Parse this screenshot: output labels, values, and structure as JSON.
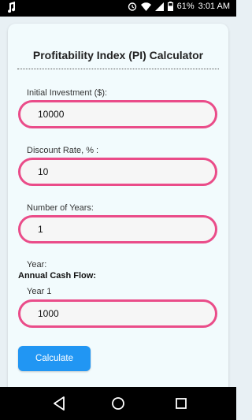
{
  "status_bar": {
    "battery_text": "61%",
    "time": "3:01 AM",
    "left_icon": "music-note-icon"
  },
  "calculator": {
    "title": "Profitability Index (PI) Calculator",
    "initial_investment": {
      "label": "Initial Investment ($):",
      "value": "10000"
    },
    "discount_rate": {
      "label": "Discount Rate, % :",
      "value": "10"
    },
    "number_of_years": {
      "label": "Number of Years:",
      "value": "1"
    },
    "year_label": "Year:",
    "annual_cash_flow_label": "Annual Cash Flow:",
    "year_1": {
      "label": "Year 1",
      "value": "1000"
    },
    "calculate_button": "Calculate"
  },
  "colors": {
    "accent_border": "#ea4c89",
    "button": "#2196f3",
    "card_background": "#f2fbfd"
  }
}
